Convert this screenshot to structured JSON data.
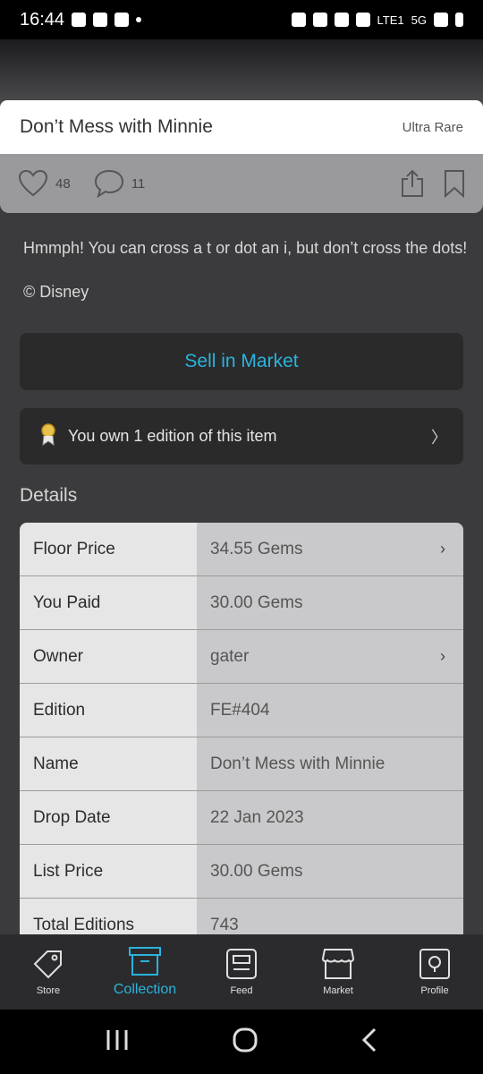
{
  "status_bar": {
    "time": "16:44",
    "network_label": "LTE1",
    "network_type": "5G"
  },
  "item": {
    "title": "Don’t Mess with Minnie",
    "rarity": "Ultra Rare",
    "likes": "48",
    "comments": "11",
    "description": "Hmmph! You can cross a t or dot an i, but don’t cross the dots!",
    "copyright": "© Disney"
  },
  "actions": {
    "sell_label": "Sell in Market",
    "own_label": "You own 1 edition of this item"
  },
  "details": {
    "heading": "Details",
    "rows": [
      {
        "label": "Floor Price",
        "value": "34.55 Gems"
      },
      {
        "label": "You Paid",
        "value": "30.00 Gems"
      },
      {
        "label": "Owner",
        "value": "gater"
      },
      {
        "label": "Edition",
        "value": "FE#404"
      },
      {
        "label": "Name",
        "value": "Don’t Mess with Minnie"
      },
      {
        "label": "Drop Date",
        "value": "22 Jan 2023"
      },
      {
        "label": "List Price",
        "value": "30.00 Gems"
      },
      {
        "label": "Total Editions",
        "value": "743"
      }
    ]
  },
  "nav": {
    "store": "Store",
    "collection": "Collection",
    "feed": "Feed",
    "market": "Market",
    "profile": "Profile"
  },
  "colors": {
    "accent": "#2bb3dd",
    "panel": "#2a2a2b",
    "background": "#3b3b3d"
  }
}
